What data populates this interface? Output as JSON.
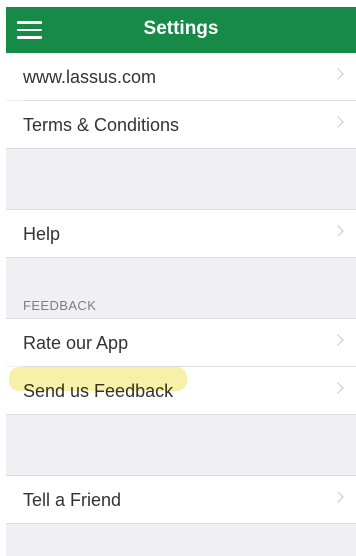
{
  "header": {
    "title": "Settings",
    "menu_icon": "hamburger-menu-icon",
    "bar_color": "#178a47"
  },
  "rows": {
    "website": {
      "label": "www.lassus.com"
    },
    "terms": {
      "label": "Terms & Conditions"
    },
    "help": {
      "label": "Help"
    },
    "rate": {
      "label": "Rate our App"
    },
    "feedback": {
      "label": "Send us Feedback"
    },
    "tell_friend": {
      "label": "Tell a Friend"
    }
  },
  "sections": {
    "feedback_header": "FEEDBACK"
  },
  "icons": {
    "row_disclosure": "chevron-right-icon"
  },
  "colors": {
    "grouped_background": "#efeff4",
    "highlight": "#f6ee9a"
  }
}
